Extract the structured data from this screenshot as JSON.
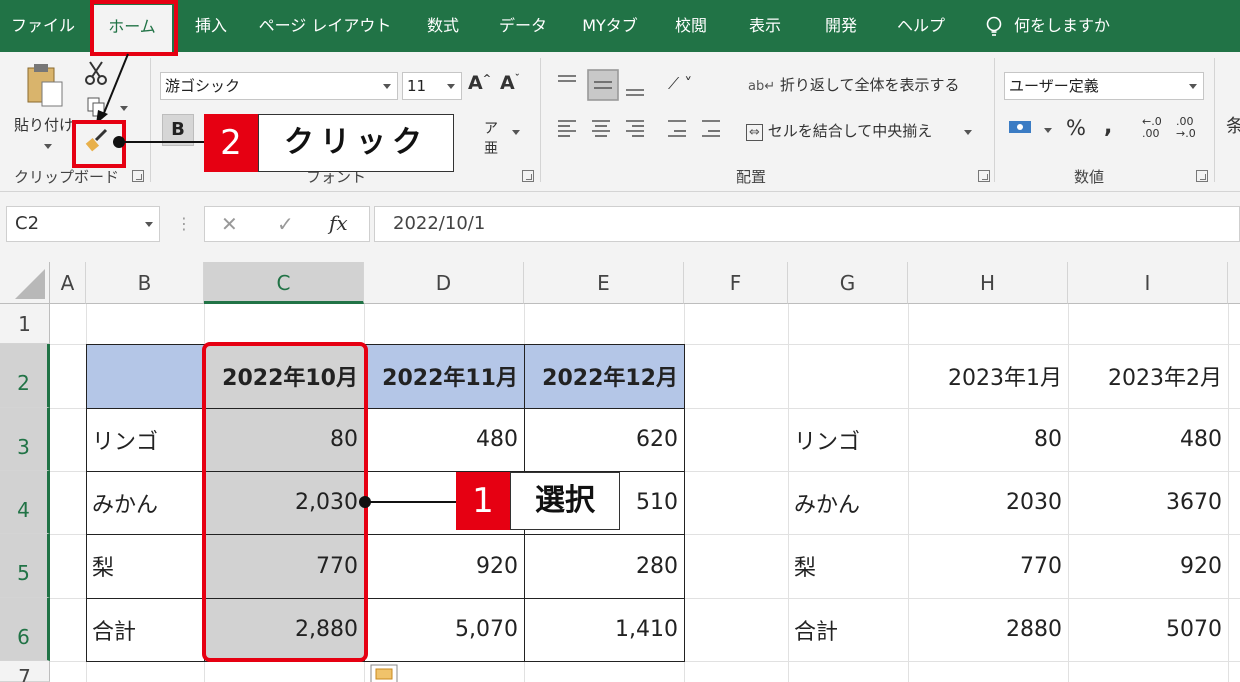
{
  "tabs": [
    {
      "label": "ファイル"
    },
    {
      "label": "ホーム"
    },
    {
      "label": "挿入"
    },
    {
      "label": "ページ レイアウト"
    },
    {
      "label": "数式"
    },
    {
      "label": "データ"
    },
    {
      "label": "MYタブ"
    },
    {
      "label": "校閲"
    },
    {
      "label": "表示"
    },
    {
      "label": "開発"
    },
    {
      "label": "ヘルプ"
    }
  ],
  "tell_me": "何をしますか",
  "ribbon": {
    "clipboard": {
      "paste_label": "貼り付け",
      "group_label": "クリップボード"
    },
    "font": {
      "font_name": "游ゴシック",
      "font_size": "11",
      "bold": "B",
      "group_label": "フォント",
      "grow": "A",
      "shrink": "A"
    },
    "alignment": {
      "wrap_text": "折り返して全体を表示する",
      "merge_center": "セルを結合して中央揃え",
      "group_label": "配置"
    },
    "number": {
      "format": "ユーザー定義",
      "percent": "%",
      "comma": ",",
      "group_label": "数値"
    },
    "cut_off_label": "条"
  },
  "formula_bar": {
    "name_box": "C2",
    "fx": "fx",
    "cancel": "✕",
    "enter": "✓",
    "formula": "2022/10/1"
  },
  "columns": [
    "A",
    "B",
    "C",
    "D",
    "E",
    "F",
    "G",
    "H",
    "I"
  ],
  "rows": [
    "1",
    "2",
    "3",
    "4",
    "5",
    "6",
    "7"
  ],
  "table1": {
    "headers": [
      "",
      "2022年10月",
      "2022年11月",
      "2022年12月"
    ],
    "rows": [
      [
        "リンゴ",
        "80",
        "480",
        "620"
      ],
      [
        "みかん",
        "2,030",
        "",
        "510"
      ],
      [
        "梨",
        "770",
        "920",
        "280"
      ],
      [
        "合計",
        "2,880",
        "5,070",
        "1,410"
      ]
    ]
  },
  "table2": {
    "headers": [
      "",
      "2023年1月",
      "2023年2月"
    ],
    "rows": [
      [
        "リンゴ",
        "80",
        "480"
      ],
      [
        "みかん",
        "2030",
        "3670"
      ],
      [
        "梨",
        "770",
        "920"
      ],
      [
        "合計",
        "2880",
        "5070"
      ]
    ]
  },
  "annotations": {
    "step1_num": "1",
    "step1_text": "選択",
    "step2_num": "2",
    "step2_text": "クリック"
  },
  "colors": {
    "excel_green": "#217346",
    "header_fill": "#b4c6e7",
    "highlight_red": "#e60012",
    "selection_gray": "#d2d2d2"
  }
}
